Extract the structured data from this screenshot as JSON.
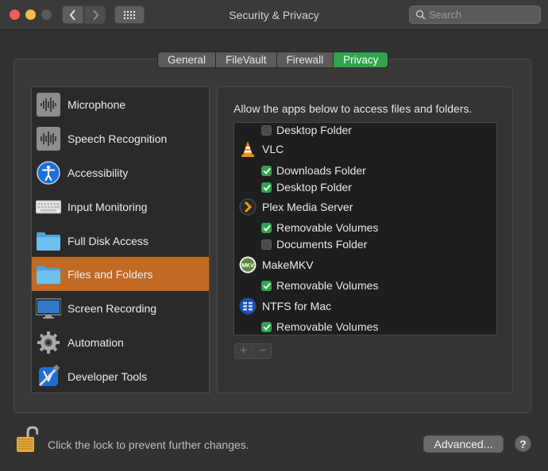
{
  "window": {
    "title": "Security & Privacy",
    "search_placeholder": "Search"
  },
  "tabs": [
    {
      "label": "General",
      "active": false
    },
    {
      "label": "FileVault",
      "active": false
    },
    {
      "label": "Firewall",
      "active": false
    },
    {
      "label": "Privacy",
      "active": true
    }
  ],
  "sidebar": {
    "items": [
      {
        "label": "Microphone",
        "icon": "microphone-icon"
      },
      {
        "label": "Speech Recognition",
        "icon": "speech-recognition-icon"
      },
      {
        "label": "Accessibility",
        "icon": "accessibility-icon"
      },
      {
        "label": "Input Monitoring",
        "icon": "keyboard-icon"
      },
      {
        "label": "Full Disk Access",
        "icon": "folder-icon"
      },
      {
        "label": "Files and Folders",
        "icon": "folder-icon",
        "selected": true
      },
      {
        "label": "Screen Recording",
        "icon": "display-icon"
      },
      {
        "label": "Automation",
        "icon": "gear-icon"
      },
      {
        "label": "Developer Tools",
        "icon": "xcode-icon"
      }
    ]
  },
  "main": {
    "description": "Allow the apps below to access files and folders.",
    "rows": [
      {
        "type": "folder",
        "label": "Desktop Folder",
        "checked": false
      },
      {
        "type": "app",
        "label": "VLC",
        "icon": "vlc-icon"
      },
      {
        "type": "folder",
        "label": "Downloads Folder",
        "checked": true
      },
      {
        "type": "folder",
        "label": "Desktop Folder",
        "checked": true
      },
      {
        "type": "app",
        "label": "Plex Media Server",
        "icon": "plex-icon"
      },
      {
        "type": "folder",
        "label": "Removable Volumes",
        "checked": true
      },
      {
        "type": "folder",
        "label": "Documents Folder",
        "checked": false
      },
      {
        "type": "app",
        "label": "MakeMKV",
        "icon": "makemkv-icon"
      },
      {
        "type": "folder",
        "label": "Removable Volumes",
        "checked": true
      },
      {
        "type": "app",
        "label": "NTFS for Mac",
        "icon": "ntfs-icon"
      },
      {
        "type": "folder",
        "label": "Removable Volumes",
        "checked": true
      }
    ],
    "plus_label": "+",
    "minus_label": "−"
  },
  "footer": {
    "lock_text": "Click the lock to prevent further changes.",
    "advanced_label": "Advanced...",
    "help_label": "?"
  },
  "colors": {
    "accent_selected": "#c06a24",
    "checkbox_checked": "#31a34e",
    "tab_active": "#31a34e"
  }
}
